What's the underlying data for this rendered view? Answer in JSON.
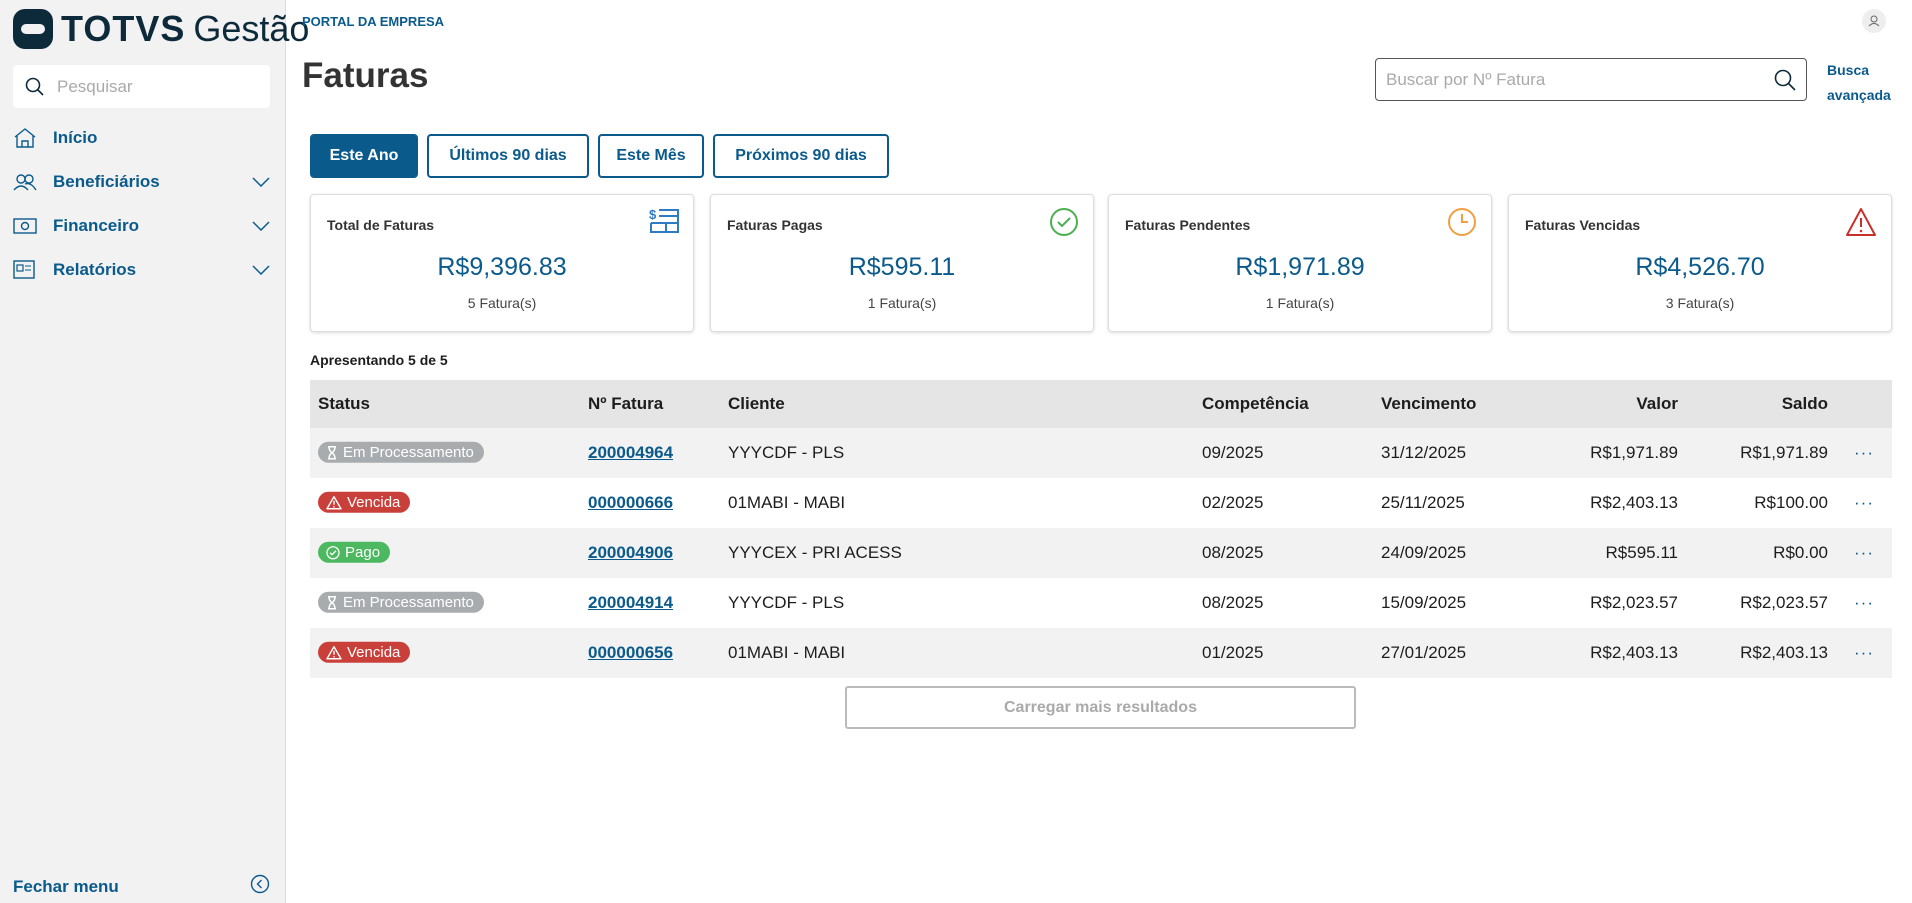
{
  "sidebar": {
    "logo_brand": "TOTVS",
    "logo_product": "Gestão",
    "search_placeholder": "Pesquisar",
    "items": [
      {
        "label": "Início"
      },
      {
        "label": "Beneficiários"
      },
      {
        "label": "Financeiro"
      },
      {
        "label": "Relatórios"
      }
    ],
    "close_label": "Fechar menu"
  },
  "header": {
    "portal": "PORTAL DA EMPRESA",
    "title": "Faturas",
    "search_placeholder": "Buscar por Nº Fatura",
    "advanced_1": "Busca",
    "advanced_2": "avançada"
  },
  "filters": [
    "Este Ano",
    "Últimos 90 dias",
    "Este Mês",
    "Próximos 90 dias"
  ],
  "cards": [
    {
      "label": "Total de Faturas",
      "value": "R$9,396.83",
      "count": "5 Fatura(s)",
      "color": "#2e7bc4"
    },
    {
      "label": "Faturas Pagas",
      "value": "R$595.11",
      "count": "1 Fatura(s)",
      "color": "#4caf50"
    },
    {
      "label": "Faturas Pendentes",
      "value": "R$1,971.89",
      "count": "1 Fatura(s)",
      "color": "#f0a040"
    },
    {
      "label": "Faturas Vencidas",
      "value": "R$4,526.70",
      "count": "3 Fatura(s)",
      "color": "#c9302c"
    }
  ],
  "summary": "Apresentando 5 de 5",
  "table": {
    "headers": [
      "Status",
      "Nº Fatura",
      "Cliente",
      "Competência",
      "Vencimento",
      "Valor",
      "Saldo"
    ],
    "rows": [
      {
        "status": "Em Processamento",
        "fatura": "200004964",
        "cliente": "YYYCDF - PLS",
        "competencia": "09/2025",
        "vencimento": "31/12/2025",
        "valor": "R$1,971.89",
        "saldo": "R$1,971.89"
      },
      {
        "status": "Vencida",
        "fatura": "000000666",
        "cliente": "01MABI - MABI",
        "competencia": "02/2025",
        "vencimento": "25/11/2025",
        "valor": "R$2,403.13",
        "saldo": "R$100.00"
      },
      {
        "status": "Pago",
        "fatura": "200004906",
        "cliente": "YYYCEX - PRI ACESS",
        "competencia": "08/2025",
        "vencimento": "24/09/2025",
        "valor": "R$595.11",
        "saldo": "R$0.00"
      },
      {
        "status": "Em Processamento",
        "fatura": "200004914",
        "cliente": "YYYCDF - PLS",
        "competencia": "08/2025",
        "vencimento": "15/09/2025",
        "valor": "R$2,023.57",
        "saldo": "R$2,023.57"
      },
      {
        "status": "Vencida",
        "fatura": "000000656",
        "cliente": "01MABI - MABI",
        "competencia": "01/2025",
        "vencimento": "27/01/2025",
        "valor": "R$2,403.13",
        "saldo": "R$2,403.13"
      }
    ]
  },
  "load_more": "Carregar mais resultados",
  "status_colors": {
    "Em Processamento": "#a8acaf",
    "Vencida": "#c9403a",
    "Pago": "#4cb860"
  }
}
